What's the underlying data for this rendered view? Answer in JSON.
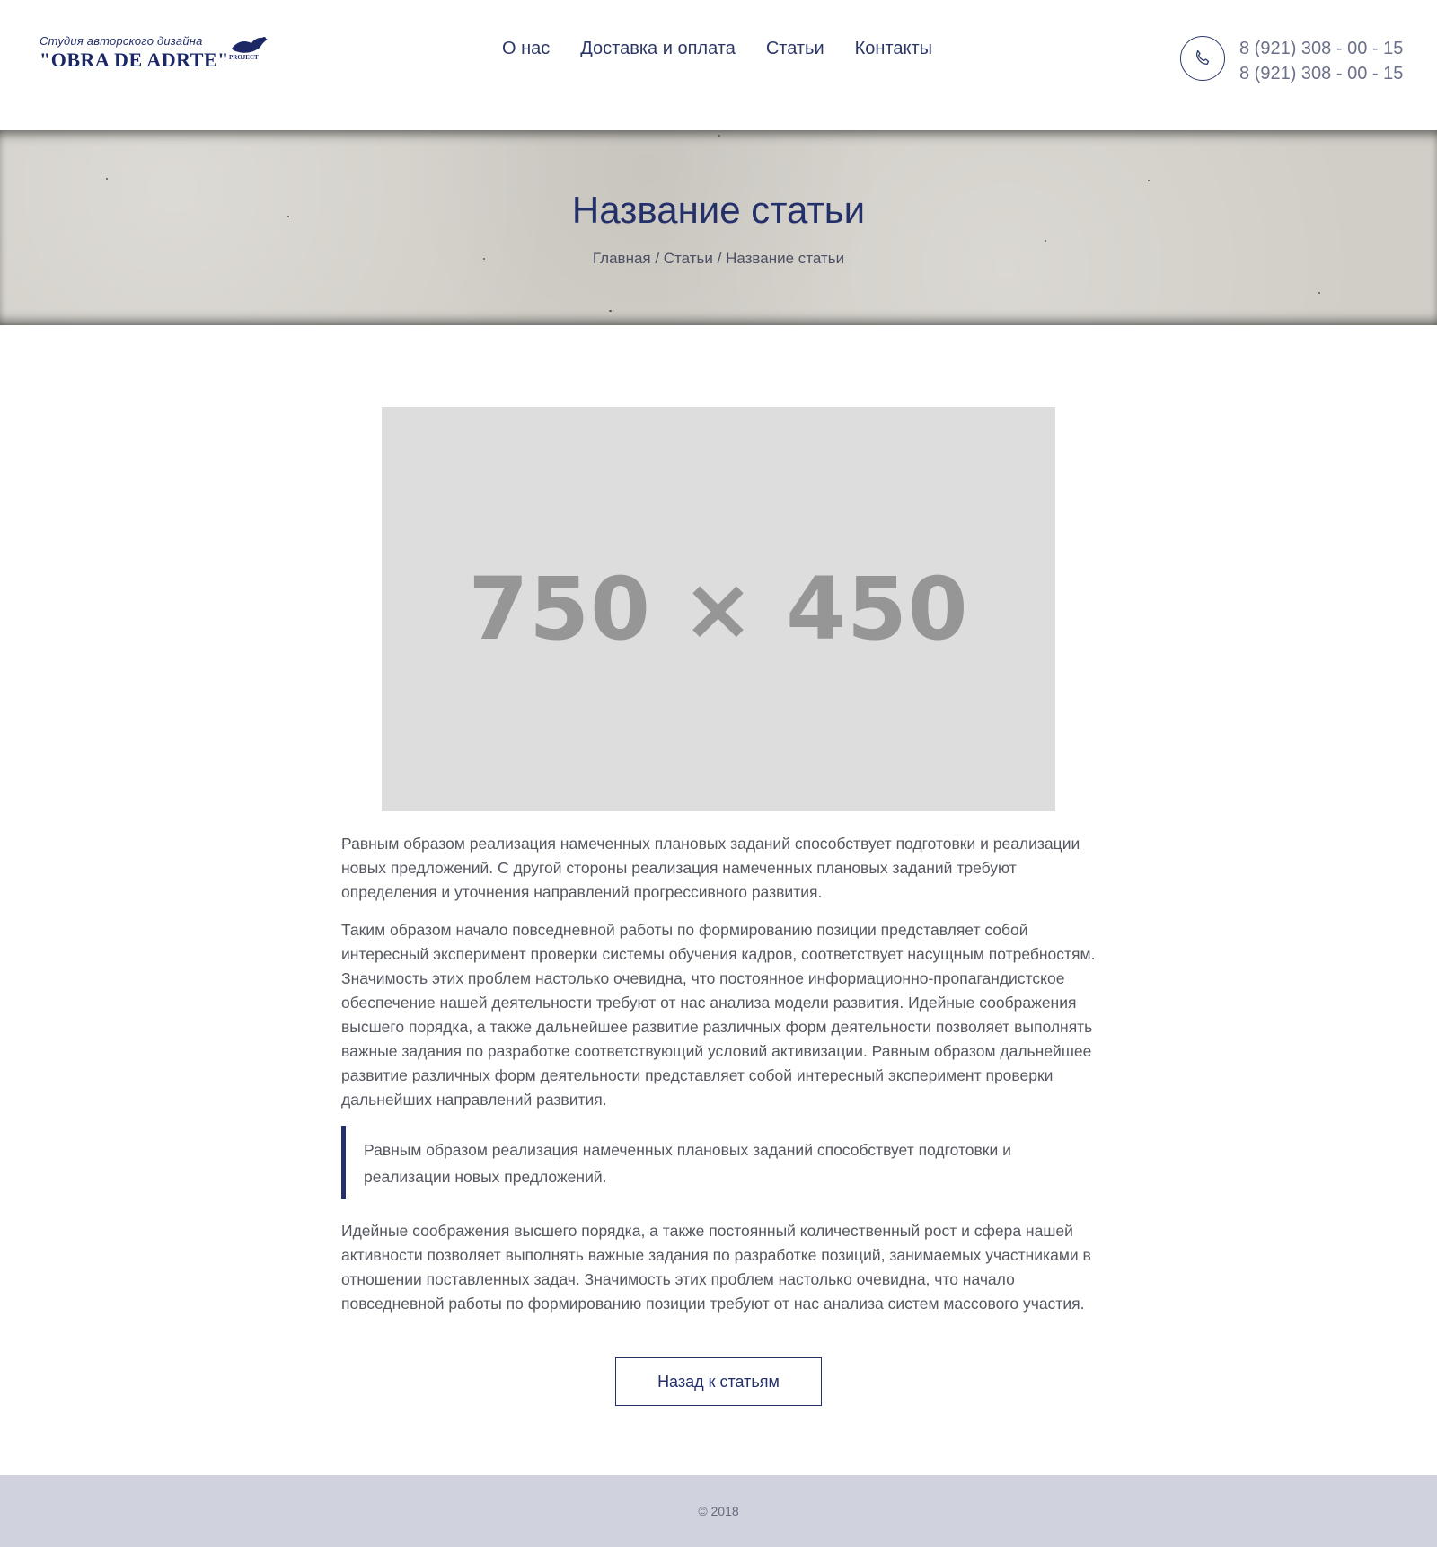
{
  "header": {
    "logo": {
      "subtitle": "Студия авторского дизайна",
      "name": "\"OBRA DE ADRTE\"",
      "tag": "PROJECT"
    },
    "nav": [
      {
        "label": "О нас"
      },
      {
        "label": "Доставка и оплата"
      },
      {
        "label": "Статьи"
      },
      {
        "label": "Контакты"
      }
    ],
    "phone_icon": "phone-icon",
    "phones": [
      "8 (921) 308 - 00 - 15",
      "8 (921) 308 - 00 - 15"
    ]
  },
  "banner": {
    "title": "Название статьи",
    "breadcrumb": {
      "home": "Главная",
      "section": "Статьи",
      "current": "Название статьи",
      "separator": " / "
    }
  },
  "article": {
    "image_placeholder": "750 × 450",
    "paragraphs": [
      "Равным образом реализация намеченных плановых заданий способствует подготовки и реализации новых предложений. С другой стороны реализация намеченных плановых заданий требуют определения и уточнения направлений прогрессивного развития.",
      "Таким образом начало повседневной работы по формированию позиции представляет собой интересный эксперимент проверки системы обучения кадров, соответствует насущным потребностям. Значимость этих проблем настолько очевидна, что постоянное информационно-пропагандистское обеспечение нашей деятельности требуют от нас анализа модели развития. Идейные соображения высшего порядка, а также дальнейшее развитие различных форм деятельности позволяет выполнять важные задания по разработке соответствующий условий активизации. Равным образом дальнейшее развитие различных форм деятельности представляет собой интересный эксперимент проверки дальнейших направлений развития."
    ],
    "quote": "Равным образом реализация намеченных плановых заданий способствует подготовки и реализации новых предложений.",
    "closing": "Идейные соображения высшего порядка, а также постоянный количественный рост и сфера нашей активности позволяет выполнять важные задания по разработке позиций, занимаемых участниками в отношении поставленных задач. Значимость этих проблем настолько очевидна, что начало повседневной работы по формированию позиции требуют от нас анализа систем массового участия.",
    "back_label": "Назад к статьям"
  },
  "footer": {
    "copyright": "© 2018"
  },
  "colors": {
    "accent": "#24306a",
    "banner_bg": "#d1cec7",
    "footer_bg": "#d0d3de",
    "placeholder_bg": "#dddddd"
  }
}
